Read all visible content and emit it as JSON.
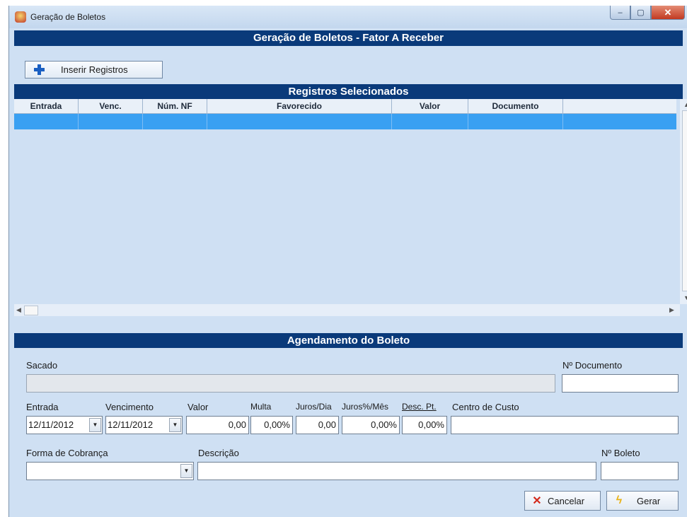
{
  "window": {
    "title": "Geração de Boletos",
    "controls": [
      "–",
      "▢",
      "✕"
    ]
  },
  "header": {
    "title": "Geração de Boletos - Fator A Receber"
  },
  "toolbar": {
    "insert_label": "Inserir Registros",
    "insert_icon": "plus-icon"
  },
  "grid": {
    "title": "Registros Selecionados",
    "columns": [
      "Entrada",
      "Venc.",
      "Núm. NF",
      "Favorecido",
      "Valor",
      "Documento",
      ""
    ]
  },
  "schedule": {
    "title": "Agendamento do Boleto",
    "sacado_label": "Sacado",
    "sacado_value": "",
    "doc_label": "Nº Documento",
    "doc_value": "",
    "entrada_label": "Entrada",
    "entrada_value": "12/11/2012",
    "vencimento_label": "Vencimento",
    "vencimento_value": "12/11/2012",
    "valor_label": "Valor",
    "valor_value": "0,00",
    "multa_label": "Multa",
    "multa_value": "0,00%",
    "juros_dia_label": "Juros/Dia",
    "juros_dia_value": "0,00",
    "juros_mes_label": "Juros%/Mês",
    "juros_mes_value": "0,00%",
    "desc_label": "Desc. Pt.",
    "desc_value": "0,00%",
    "centro_label": "Centro de Custo",
    "centro_value": "",
    "forma_label": "Forma de Cobrança",
    "forma_value": "",
    "descricao_label": "Descrição",
    "descricao_value": "",
    "boleto_label": "Nº Boleto",
    "boleto_value": ""
  },
  "actions": {
    "cancel_label": "Cancelar",
    "generate_label": "Gerar"
  },
  "colors": {
    "header_band": "#0a3a7a",
    "panel_bg": "#cfe0f3",
    "selected_row": "#39a0f2"
  }
}
